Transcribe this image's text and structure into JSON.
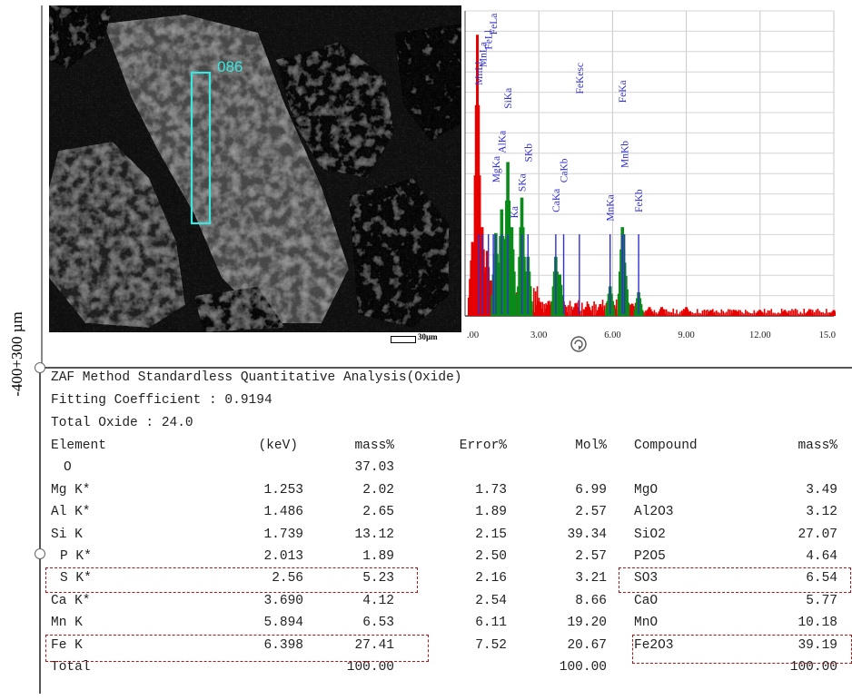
{
  "side_label": "-400+300 µm",
  "sem_image": {
    "roi_label": "086",
    "scale_bar_label": "30µm"
  },
  "chart_data": {
    "type": "bar",
    "x_ticks": [
      ".00",
      "3.00",
      "6.00",
      "9.00",
      "12.00",
      "15.0"
    ],
    "xlim": [
      0,
      15
    ],
    "grid": true,
    "peak_labels": [
      {
        "text": "MnLl",
        "x": 0.55,
        "y": 0.78
      },
      {
        "text": "MnLa",
        "x": 0.72,
        "y": 0.84
      },
      {
        "text": "FeLl",
        "x": 0.95,
        "y": 0.9
      },
      {
        "text": "FeLa",
        "x": 1.15,
        "y": 0.95
      },
      {
        "text": "MgKa",
        "x": 1.25,
        "y": 0.45
      },
      {
        "text": "AlKa",
        "x": 1.49,
        "y": 0.55
      },
      {
        "text": "SiKa",
        "x": 1.74,
        "y": 0.7
      },
      {
        "text": "Ka",
        "x": 2.0,
        "y": 0.33
      },
      {
        "text": "SKa",
        "x": 2.31,
        "y": 0.42
      },
      {
        "text": "SKb",
        "x": 2.56,
        "y": 0.52
      },
      {
        "text": "CaKa",
        "x": 3.69,
        "y": 0.35
      },
      {
        "text": "CaKb",
        "x": 4.01,
        "y": 0.45
      },
      {
        "text": "FeKesc",
        "x": 4.65,
        "y": 0.75
      },
      {
        "text": "MnKa",
        "x": 5.9,
        "y": 0.32
      },
      {
        "text": "MnKb",
        "x": 6.49,
        "y": 0.5
      },
      {
        "text": "FeKa",
        "x": 6.4,
        "y": 0.72
      },
      {
        "text": "FeKb",
        "x": 7.06,
        "y": 0.35
      }
    ],
    "series": [
      {
        "color": "#e60000",
        "values": [
          [
            0.3,
            0.25
          ],
          [
            0.5,
            0.95
          ],
          [
            0.7,
            0.3
          ],
          [
            0.9,
            0.22
          ],
          [
            1.05,
            0.12
          ],
          [
            1.25,
            0.14
          ],
          [
            1.5,
            0.1
          ],
          [
            1.75,
            0.12
          ],
          [
            2.0,
            0.08
          ],
          [
            2.3,
            0.09
          ],
          [
            2.6,
            0.07
          ],
          [
            3.0,
            0.05
          ],
          [
            3.4,
            0.05
          ],
          [
            3.7,
            0.06
          ],
          [
            4.0,
            0.05
          ],
          [
            4.5,
            0.04
          ],
          [
            5.0,
            0.04
          ],
          [
            5.5,
            0.04
          ],
          [
            6.0,
            0.05
          ],
          [
            6.4,
            0.06
          ],
          [
            6.8,
            0.04
          ],
          [
            7.5,
            0.03
          ],
          [
            8.0,
            0.03
          ],
          [
            9.0,
            0.03
          ],
          [
            10.0,
            0.02
          ],
          [
            11.0,
            0.02
          ],
          [
            12.0,
            0.02
          ],
          [
            13.0,
            0.02
          ],
          [
            14.0,
            0.02
          ],
          [
            15.0,
            0.02
          ]
        ]
      },
      {
        "color": "#0a8a1a",
        "values": [
          [
            1.25,
            0.28
          ],
          [
            1.49,
            0.36
          ],
          [
            1.74,
            0.52
          ],
          [
            1.9,
            0.3
          ],
          [
            2.31,
            0.4
          ],
          [
            2.56,
            0.2
          ],
          [
            3.69,
            0.2
          ],
          [
            3.85,
            0.14
          ],
          [
            5.9,
            0.1
          ],
          [
            6.4,
            0.3
          ],
          [
            6.49,
            0.18
          ],
          [
            7.06,
            0.08
          ]
        ]
      }
    ],
    "marker_color": "#3030d0",
    "marker_positions": [
      0.55,
      0.72,
      0.95,
      1.15,
      1.25,
      1.49,
      1.74,
      2.31,
      2.56,
      3.69,
      4.01,
      4.65,
      5.9,
      6.4,
      6.49,
      7.06
    ]
  },
  "report": {
    "title": "ZAF Method Standardless Quantitative Analysis(Oxide)",
    "fitting": "Fitting Coefficient : 0.9194",
    "total_oxide": "Total Oxide : 24.0",
    "headers": [
      "Element",
      "(keV)",
      "mass%",
      "Error%",
      "Mol%",
      "Compound",
      "mass%"
    ],
    "rows": [
      [
        "O",
        "",
        "37.03",
        "",
        "",
        "",
        ""
      ],
      [
        "Mg K*",
        "1.253",
        "2.02",
        "1.73",
        "6.99",
        "MgO",
        "3.49"
      ],
      [
        "Al K*",
        "1.486",
        "2.65",
        "1.89",
        "2.57",
        "Al2O3",
        "3.12"
      ],
      [
        "Si K",
        "1.739",
        "13.12",
        "2.15",
        "39.34",
        "SiO2",
        "27.07"
      ],
      [
        "P K*",
        "2.013",
        "1.89",
        "2.50",
        "2.57",
        "P2O5",
        "4.64"
      ],
      [
        "S K*",
        "2.56",
        "5.23",
        "2.16",
        "3.21",
        "SO3",
        "6.54"
      ],
      [
        "Ca K*",
        "3.690",
        "4.12",
        "2.54",
        "8.66",
        "CaO",
        "5.77"
      ],
      [
        "Mn K",
        "5.894",
        "6.53",
        "6.11",
        "19.20",
        "MnO",
        "10.18"
      ],
      [
        "Fe K",
        "6.398",
        "27.41",
        "7.52",
        "20.67",
        "Fe2O3",
        "39.19"
      ],
      [
        "Total",
        "",
        "100.00",
        "",
        "100.00",
        "",
        "100.00"
      ]
    ],
    "highlight_color": "#b01515"
  }
}
